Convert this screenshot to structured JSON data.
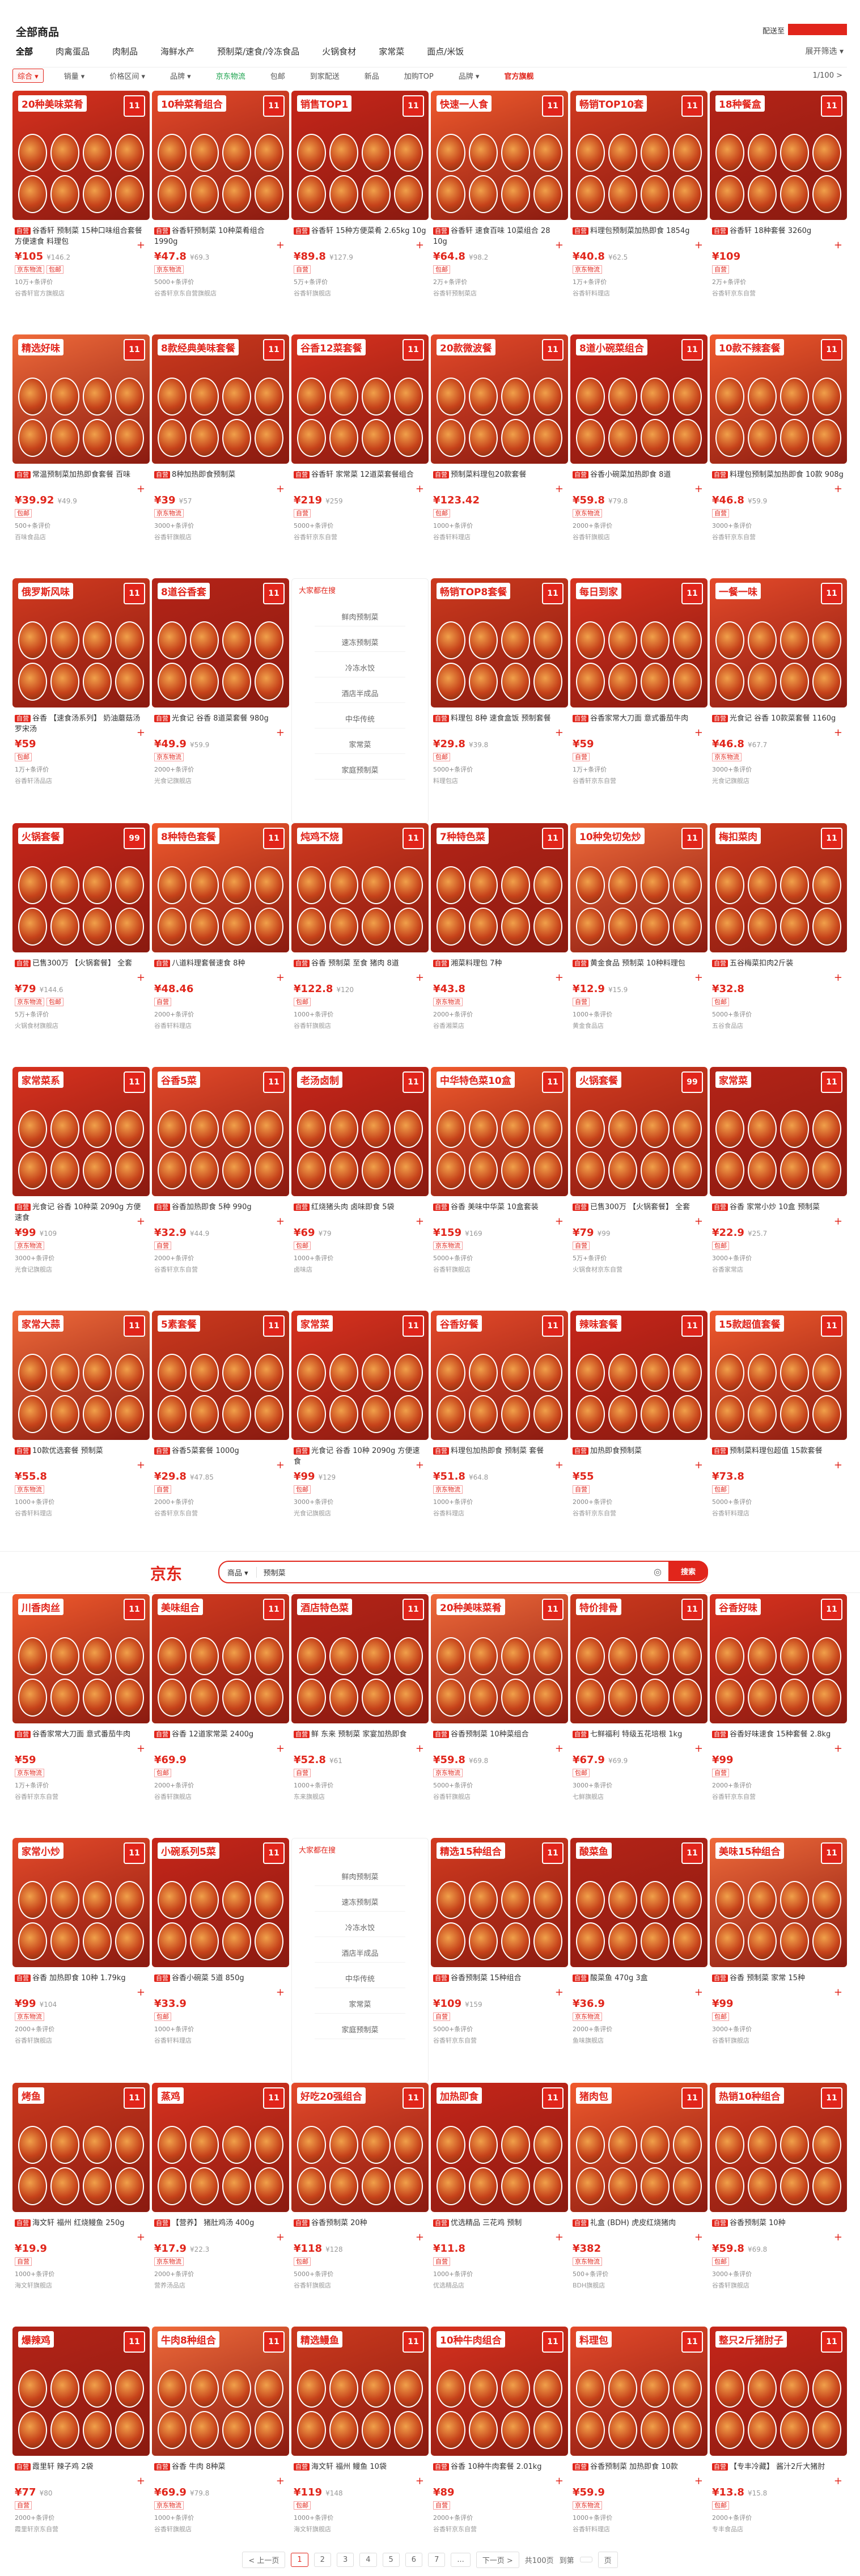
{
  "header": {
    "title": "全部商品",
    "breadcrumb": "配送至",
    "categories": [
      "全部",
      "肉禽蛋品",
      "肉制品",
      "海鲜水产",
      "预制菜/速食/冷冻食品",
      "火锅食材",
      "家常菜",
      "面点/米饭"
    ],
    "more": "展开筛选 ▾"
  },
  "filters": [
    "综合 ▾",
    "销量 ▾",
    "价格区间 ▾",
    "品牌 ▾",
    "京东物流",
    "包邮",
    "到家配送",
    "新品",
    "加购TOP",
    "品牌 ▾",
    "官方旗舰",
    "1/100 >"
  ],
  "grid1": [
    {
      "badge": "20种美味菜肴",
      "num": "11",
      "name": "谷香轩 预制菜 15种口味组合套餐 方便速食 料理包",
      "note": "",
      "price": "¥105",
      "orig": "¥146.2",
      "tags": [
        "京东物流",
        "包邮"
      ],
      "meta": "10万+条评价",
      "shop": "谷香轩官方旗舰店"
    },
    {
      "badge": "10种菜肴组合",
      "num": "11",
      "name": "谷香轩预制菜 10种菜肴组合1990g",
      "note": "",
      "price": "¥47.8",
      "orig": "¥69.3",
      "tags": [
        "京东物流"
      ],
      "meta": "5000+条评价",
      "shop": "谷香轩京东自营旗舰店"
    },
    {
      "badge": "销售TOP1",
      "num": "11",
      "name": "谷香轩 15种方便菜肴 2.65kg 10g",
      "note": "",
      "price": "¥89.8",
      "orig": "¥127.9",
      "tags": [
        "自营"
      ],
      "meta": "5万+条评价",
      "shop": "谷香轩旗舰店"
    },
    {
      "badge": "快速一人食",
      "num": "11",
      "name": "谷香轩 速食百味 10菜组合 28 10g",
      "note": "",
      "price": "¥64.8",
      "orig": "¥98.2",
      "tags": [
        "包邮"
      ],
      "meta": "2万+条评价",
      "shop": "谷香轩预制菜店"
    },
    {
      "badge": "畅销TOP10套",
      "num": "11",
      "name": "料理包预制菜加热即食 1854g",
      "note": "",
      "price": "¥40.8",
      "orig": "¥62.5",
      "tags": [
        "京东物流"
      ],
      "meta": "1万+条评价",
      "shop": "谷香轩料理店"
    },
    {
      "badge": "18种餐盒",
      "num": "11",
      "name": "谷香轩 18种套餐 3260g",
      "note": "",
      "price": "¥109",
      "orig": "",
      "tags": [
        "自营"
      ],
      "meta": "2万+条评价",
      "shop": "谷香轩京东自营"
    },
    {
      "badge": "精选好味",
      "num": "11",
      "name": "常温预制菜加热即食套餐 百味",
      "note": "",
      "price": "¥39.92",
      "orig": "¥49.9",
      "tags": [
        "包邮"
      ],
      "meta": "500+条评价",
      "shop": "百味食品店"
    },
    {
      "badge": "8款经典美味套餐",
      "num": "11",
      "name": "8种加热即食预制菜",
      "note": "",
      "price": "¥39",
      "orig": "¥57",
      "tags": [
        "京东物流"
      ],
      "meta": "3000+条评价",
      "shop": "谷香轩旗舰店"
    },
    {
      "badge": "谷香12菜套餐",
      "num": "11",
      "name": "谷香轩 家常菜 12道菜套餐组合",
      "note": "",
      "price": "¥219",
      "orig": "¥259",
      "tags": [
        "自营"
      ],
      "meta": "5000+条评价",
      "shop": "谷香轩京东自营"
    },
    {
      "badge": "20款微波餐",
      "num": "11",
      "name": "预制菜料理包20款套餐",
      "note": "",
      "price": "¥123.42",
      "orig": "",
      "tags": [
        "包邮"
      ],
      "meta": "1000+条评价",
      "shop": "谷香轩料理店"
    },
    {
      "badge": "8道小碗菜组合",
      "num": "11",
      "name": "谷香小碗菜加热即食 8道",
      "note": "",
      "price": "¥59.8",
      "orig": "¥79.8",
      "tags": [
        "京东物流"
      ],
      "meta": "2000+条评价",
      "shop": "谷香轩旗舰店"
    },
    {
      "badge": "10款不辣套餐",
      "num": "11",
      "name": "料理包预制菜加热即食 10款 908g",
      "note": "",
      "price": "¥46.8",
      "orig": "¥59.9",
      "tags": [
        "自营"
      ],
      "meta": "3000+条评价",
      "shop": "谷香轩京东自营"
    },
    {
      "badge": "俄罗斯风味",
      "num": "11",
      "name": "谷香 【速食汤系列】 奶油蘑菇汤 罗宋汤",
      "note": "",
      "price": "¥59",
      "orig": "",
      "tags": [
        "包邮"
      ],
      "meta": "1万+条评价",
      "shop": "谷香轩汤品店"
    },
    {
      "badge": "8道谷香套",
      "num": "11",
      "name": "光食记 谷香 8道菜套餐 980g",
      "note": "",
      "price": "¥49.9",
      "orig": "¥59.9",
      "tags": [
        "京东物流"
      ],
      "meta": "2000+条评价",
      "shop": "光食记旗舰店"
    },
    {
      "side": true
    },
    {
      "badge": "畅销TOP8套餐",
      "num": "11",
      "name": "料理包 8种 速食盒饭 预制套餐",
      "note": "",
      "price": "¥29.8",
      "orig": "¥39.8",
      "tags": [
        "包邮"
      ],
      "meta": "5000+条评价",
      "shop": "料理包店"
    },
    {
      "badge": "每日到家",
      "num": "11",
      "name": "谷香家常大刀面 意式番茄牛肉",
      "note": "",
      "price": "¥59",
      "orig": "",
      "tags": [
        "自营"
      ],
      "meta": "1万+条评价",
      "shop": "谷香轩京东自营"
    },
    {
      "badge": "一餐一味",
      "num": "11",
      "name": "光食记 谷香 10款菜套餐 1160g",
      "note": "",
      "price": "¥46.8",
      "orig": "¥67.7",
      "tags": [
        "京东物流"
      ],
      "meta": "3000+条评价",
      "shop": "光食记旗舰店"
    },
    {
      "badge": "火锅套餐",
      "num": "99",
      "name": "已售300万 【火锅套餐】 全套",
      "note": "",
      "price": "¥79",
      "orig": "¥144.6",
      "tags": [
        "京东物流",
        "包邮"
      ],
      "meta": "5万+条评价",
      "shop": "火锅食材旗舰店"
    },
    {
      "badge": "8种特色套餐",
      "num": "11",
      "name": "八道料理套餐速食 8种",
      "note": "",
      "price": "¥48.46",
      "orig": "",
      "tags": [
        "自营"
      ],
      "meta": "2000+条评价",
      "shop": "谷香轩料理店"
    },
    {
      "badge": "炖鸡不烧",
      "num": "11",
      "name": "谷香 预制菜 至食 猪肉 8道",
      "note": "",
      "price": "¥122.8",
      "orig": "¥120",
      "tags": [
        "包邮"
      ],
      "meta": "1000+条评价",
      "shop": "谷香轩旗舰店"
    },
    {
      "badge": "7种特色菜",
      "num": "11",
      "name": "湘菜料理包 7种",
      "note": "",
      "price": "¥43.8",
      "orig": "",
      "tags": [
        "京东物流"
      ],
      "meta": "2000+条评价",
      "shop": "谷香湘菜店"
    },
    {
      "badge": "10种免切免炒",
      "num": "11",
      "name": "黄金食品 预制菜 10种料理包",
      "note": "",
      "price": "¥12.9",
      "orig": "¥15.9",
      "tags": [
        "自营"
      ],
      "meta": "1000+条评价",
      "shop": "黄金食品店"
    },
    {
      "badge": "梅扣菜肉",
      "num": "11",
      "name": "五谷梅菜扣肉2斤装",
      "note": "",
      "price": "¥32.8",
      "orig": "",
      "tags": [
        "包邮"
      ],
      "meta": "5000+条评价",
      "shop": "五谷食品店"
    },
    {
      "badge": "家常菜系",
      "num": "11",
      "name": "光食记 谷香 10种菜 2090g 方便速食",
      "note": "",
      "price": "¥99",
      "orig": "¥109",
      "tags": [
        "京东物流"
      ],
      "meta": "3000+条评价",
      "shop": "光食记旗舰店"
    },
    {
      "badge": "谷香5菜",
      "num": "11",
      "name": "谷香加热即食 5种 990g",
      "note": "",
      "price": "¥32.9",
      "orig": "¥44.9",
      "tags": [
        "自营"
      ],
      "meta": "2000+条评价",
      "shop": "谷香轩京东自营"
    },
    {
      "badge": "老汤卤制",
      "num": "11",
      "name": "红烧猪头肉 卤味即食 5袋",
      "note": "",
      "price": "¥69",
      "orig": "¥79",
      "tags": [
        "包邮"
      ],
      "meta": "1000+条评价",
      "shop": "卤味店"
    },
    {
      "badge": "中华特色菜10盒",
      "num": "11",
      "name": "谷香 美味中华菜 10盒套装",
      "note": "",
      "price": "¥159",
      "orig": "¥169",
      "tags": [
        "京东物流"
      ],
      "meta": "5000+条评价",
      "shop": "谷香轩旗舰店"
    },
    {
      "badge": "火锅套餐",
      "num": "99",
      "name": "已售300万 【火锅套餐】 全套",
      "note": "",
      "price": "¥79",
      "orig": "¥99",
      "tags": [
        "自营"
      ],
      "meta": "5万+条评价",
      "shop": "火锅食材京东自营"
    },
    {
      "badge": "家常菜",
      "num": "11",
      "name": "谷香 家常小炒 10盒 预制菜",
      "note": "",
      "price": "¥22.9",
      "orig": "¥25.7",
      "tags": [
        "包邮"
      ],
      "meta": "3000+条评价",
      "shop": "谷香家常店"
    },
    {
      "badge": "家常大蒜",
      "num": "11",
      "name": "10款优选套餐 预制菜",
      "note": "",
      "price": "¥55.8",
      "orig": "",
      "tags": [
        "京东物流"
      ],
      "meta": "1000+条评价",
      "shop": "谷香轩料理店"
    },
    {
      "badge": "5素套餐",
      "num": "11",
      "name": "谷香5菜套餐 1000g",
      "note": "",
      "price": "¥29.8",
      "orig": "¥47.85",
      "tags": [
        "自营"
      ],
      "meta": "2000+条评价",
      "shop": "谷香轩京东自营"
    },
    {
      "badge": "家常菜",
      "num": "11",
      "name": "光食记 谷香 10种 2090g 方便速食",
      "note": "",
      "price": "¥99",
      "orig": "¥129",
      "tags": [
        "包邮"
      ],
      "meta": "3000+条评价",
      "shop": "光食记旗舰店"
    },
    {
      "badge": "谷香好餐",
      "num": "11",
      "name": "料理包加热即食 预制菜 套餐",
      "note": "",
      "price": "¥51.8",
      "orig": "¥64.8",
      "tags": [
        "京东物流"
      ],
      "meta": "1000+条评价",
      "shop": "谷香料理店"
    },
    {
      "badge": "辣味套餐",
      "num": "11",
      "name": "加热即食预制菜",
      "note": "",
      "price": "¥55",
      "orig": "",
      "tags": [
        "自营"
      ],
      "meta": "2000+条评价",
      "shop": "谷香轩京东自营"
    },
    {
      "badge": "15款超值套餐",
      "num": "11",
      "name": "预制菜料理包超值 15款套餐",
      "note": "",
      "price": "¥73.8",
      "orig": "",
      "tags": [
        "包邮"
      ],
      "meta": "5000+条评价",
      "shop": "谷香轩料理店"
    }
  ],
  "side": {
    "heading": "大家都在搜",
    "items": [
      "鲜肉预制菜",
      "速冻预制菜",
      "冷冻水饺",
      "酒店半成品",
      "中华传统",
      "家常菜",
      "家庭预制菜"
    ]
  },
  "jd": {
    "logo": "京东",
    "scope": "商品 ▾",
    "keyword": "预制菜",
    "search_btn": "搜索",
    "camera": "◎"
  },
  "grid2": [
    {
      "badge": "川香肉丝",
      "num": "11",
      "name": "谷香家常大刀面 意式番茄牛肉",
      "price": "¥59",
      "orig": "",
      "tags": [
        "京东物流"
      ],
      "meta": "1万+条评价",
      "shop": "谷香轩京东自营"
    },
    {
      "badge": "美味组合",
      "num": "11",
      "name": "谷香 12道家常菜 2400g",
      "price": "¥69.9",
      "orig": "",
      "tags": [
        "包邮"
      ],
      "meta": "2000+条评价",
      "shop": "谷香轩旗舰店"
    },
    {
      "badge": "酒店特色菜",
      "num": "11",
      "name": "鲜 东来 预制菜 家宴加热即食",
      "price": "¥52.8",
      "orig": "¥61",
      "tags": [
        "自营"
      ],
      "meta": "1000+条评价",
      "shop": "东来旗舰店"
    },
    {
      "badge": "20种美味菜肴",
      "num": "11",
      "name": "谷香预制菜 10种菜组合",
      "price": "¥59.8",
      "orig": "¥69.8",
      "tags": [
        "京东物流"
      ],
      "meta": "5000+条评价",
      "shop": "谷香轩旗舰店"
    },
    {
      "badge": "特价排骨",
      "num": "11",
      "name": "七鲜福利 特级五花培根 1kg",
      "price": "¥67.9",
      "orig": "¥69.9",
      "tags": [
        "包邮"
      ],
      "meta": "3000+条评价",
      "shop": "七鲜旗舰店"
    },
    {
      "badge": "谷香好味",
      "num": "11",
      "name": "谷香好味速食 15种套餐 2.8kg",
      "price": "¥99",
      "orig": "",
      "tags": [
        "自营"
      ],
      "meta": "2000+条评价",
      "shop": "谷香轩京东自营"
    },
    {
      "badge": "家常小炒",
      "num": "11",
      "name": "谷香 加热即食 10种 1.79kg",
      "price": "¥99",
      "orig": "¥104",
      "tags": [
        "京东物流"
      ],
      "meta": "2000+条评价",
      "shop": "谷香轩旗舰店"
    },
    {
      "badge": "小碗系列5菜",
      "num": "11",
      "name": "谷香小碗菜 5道 850g",
      "price": "¥33.9",
      "orig": "",
      "tags": [
        "包邮"
      ],
      "meta": "1000+条评价",
      "shop": "谷香轩料理店"
    },
    {
      "side": true
    },
    {
      "badge": "精选15种组合",
      "num": "11",
      "name": "谷香预制菜 15种组合",
      "price": "¥109",
      "orig": "¥159",
      "tags": [
        "自营"
      ],
      "meta": "5000+条评价",
      "shop": "谷香轩京东自营"
    },
    {
      "badge": "酸菜鱼",
      "num": "11",
      "name": "酸菜鱼 470g 3盒",
      "price": "¥36.9",
      "orig": "",
      "tags": [
        "京东物流"
      ],
      "meta": "2000+条评价",
      "shop": "鱼味旗舰店"
    },
    {
      "badge": "美味15种组合",
      "num": "11",
      "name": "谷香 预制菜 家常 15种",
      "price": "¥99",
      "orig": "",
      "tags": [
        "包邮"
      ],
      "meta": "3000+条评价",
      "shop": "谷香轩旗舰店"
    },
    {
      "badge": "烤鱼",
      "num": "11",
      "name": "海文轩 福州 红烧鳗鱼 250g",
      "price": "¥19.9",
      "orig": "",
      "tags": [
        "自营"
      ],
      "meta": "1000+条评价",
      "shop": "海文轩旗舰店"
    },
    {
      "badge": "蒸鸡",
      "num": "11",
      "name": "【营养】 猪肚鸡汤 400g",
      "price": "¥17.9",
      "orig": "¥22.3",
      "tags": [
        "京东物流"
      ],
      "meta": "2000+条评价",
      "shop": "营养汤品店"
    },
    {
      "badge": "好吃20强组合",
      "num": "11",
      "name": "谷香预制菜 20种",
      "price": "¥118",
      "orig": "¥128",
      "tags": [
        "包邮"
      ],
      "meta": "5000+条评价",
      "shop": "谷香轩旗舰店"
    },
    {
      "badge": "加热即食",
      "num": "11",
      "name": "优选精品 三花鸡 预制",
      "price": "¥11.8",
      "orig": "",
      "tags": [
        "自营"
      ],
      "meta": "1000+条评价",
      "shop": "优选精品店"
    },
    {
      "badge": "猪肉包",
      "num": "11",
      "name": "礼盒 (BDH) 虎皮红烧猪肉",
      "price": "¥382",
      "orig": "",
      "tags": [
        "京东物流"
      ],
      "meta": "500+条评价",
      "shop": "BDH旗舰店"
    },
    {
      "badge": "热销10种组合",
      "num": "11",
      "name": "谷香预制菜 10种",
      "price": "¥59.8",
      "orig": "¥69.8",
      "tags": [
        "包邮"
      ],
      "meta": "3000+条评价",
      "shop": "谷香轩旗舰店"
    },
    {
      "badge": "爆辣鸡",
      "num": "11",
      "name": "霞里轩 辣子鸡 2袋",
      "price": "¥77",
      "orig": "¥80",
      "tags": [
        "自营"
      ],
      "meta": "2000+条评价",
      "shop": "霞里轩京东自营"
    },
    {
      "badge": "牛肉8种组合",
      "num": "11",
      "name": "谷香 牛肉 8种菜",
      "price": "¥69.9",
      "orig": "¥79.8",
      "tags": [
        "京东物流"
      ],
      "meta": "1000+条评价",
      "shop": "谷香轩旗舰店"
    },
    {
      "badge": "精选鳗鱼",
      "num": "11",
      "name": "海文轩 福州 鳗鱼 10袋",
      "price": "¥119",
      "orig": "¥148",
      "tags": [
        "包邮"
      ],
      "meta": "1000+条评价",
      "shop": "海文轩旗舰店"
    },
    {
      "badge": "10种牛肉组合",
      "num": "11",
      "name": "谷香 10种牛肉套餐 2.01kg",
      "price": "¥89",
      "orig": "",
      "tags": [
        "自营"
      ],
      "meta": "2000+条评价",
      "shop": "谷香轩京东自营"
    },
    {
      "badge": "料理包",
      "num": "11",
      "name": "谷香预制菜 加热即食 10款",
      "price": "¥59.9",
      "orig": "",
      "tags": [
        "京东物流"
      ],
      "meta": "1000+条评价",
      "shop": "谷香轩料理店"
    },
    {
      "badge": "整只2斤猪肘子",
      "num": "11",
      "name": "【专丰冷藏】 酱汁2斤大猪肘",
      "price": "¥13.8",
      "orig": "¥15.8",
      "tags": [
        "包邮"
      ],
      "meta": "2000+条评价",
      "shop": "专丰食品店"
    }
  ],
  "pagination": {
    "prev": "< 上一页",
    "pages": [
      "1",
      "2",
      "3",
      "4",
      "5",
      "6",
      "7",
      "..."
    ],
    "next": "下一页 >",
    "total": "共100页",
    "goto": "到第",
    "ok": "页"
  }
}
